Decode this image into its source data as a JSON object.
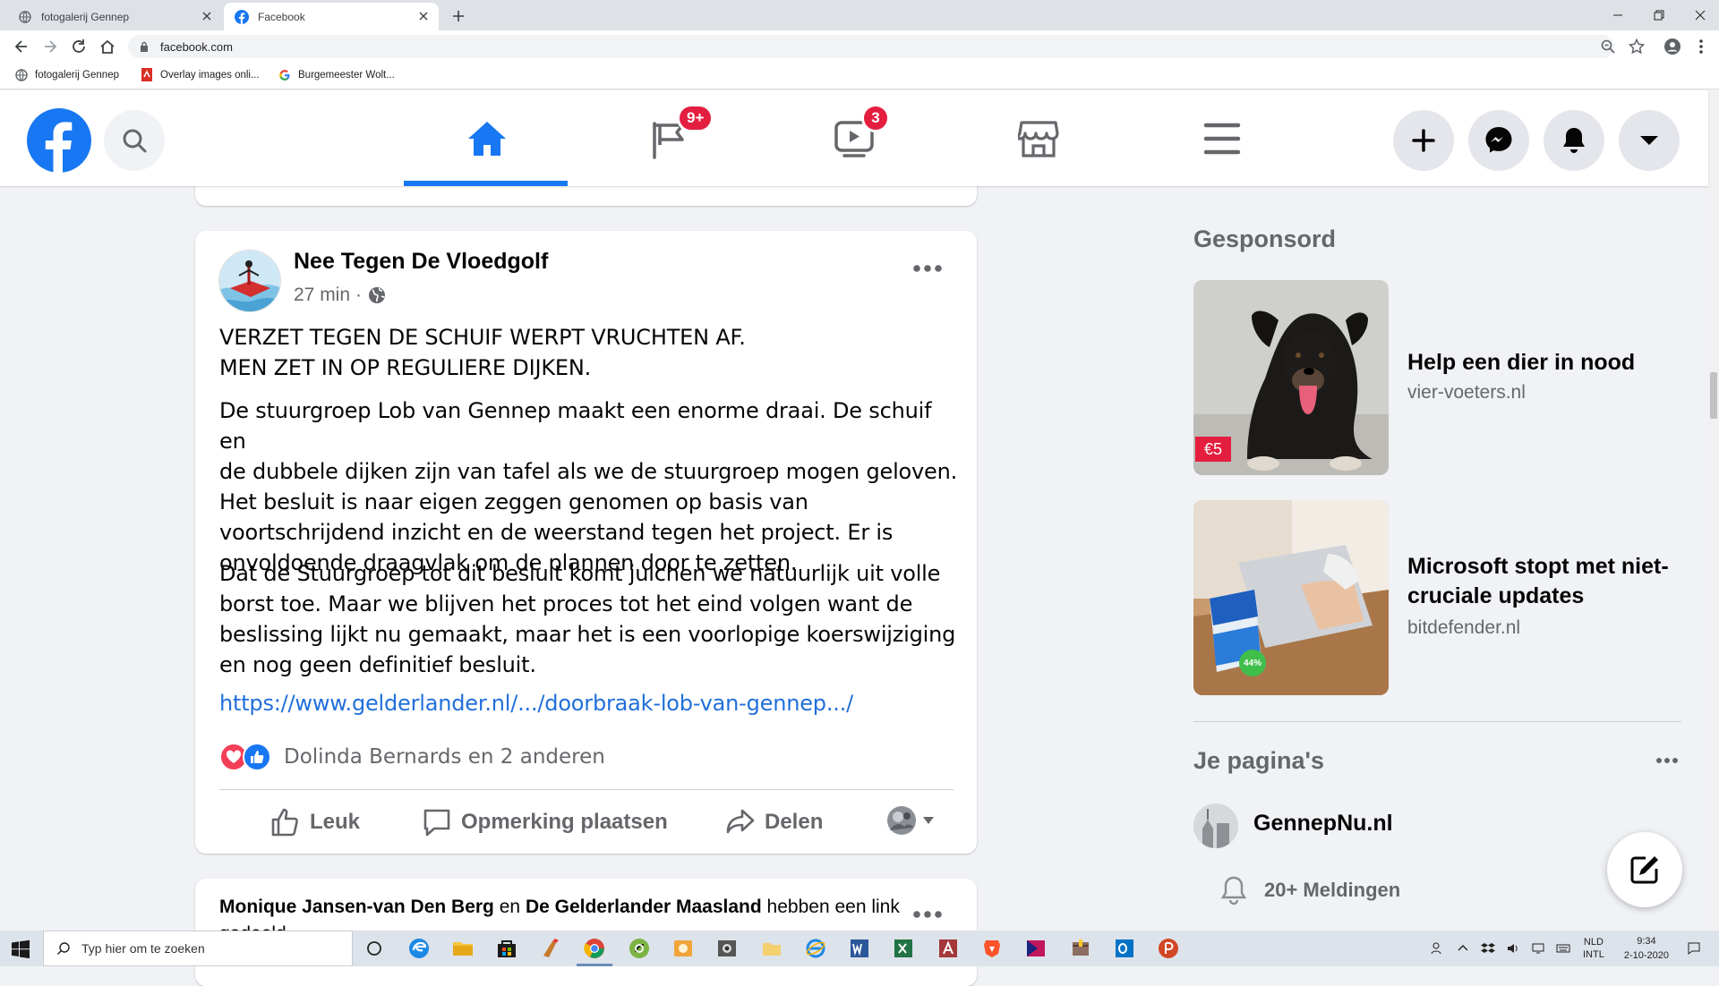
{
  "browser": {
    "tabs": [
      {
        "title": "fotogalerij Gennep",
        "active": false,
        "icon": "globe-icon"
      },
      {
        "title": "Facebook",
        "active": true,
        "icon": "facebook-favicon-icon"
      }
    ],
    "url": "facebook.com",
    "bookmarks": [
      {
        "label": "fotogalerij Gennep",
        "icon": "globe-icon"
      },
      {
        "label": "Overlay images onli...",
        "icon": "pdf-tool-icon"
      },
      {
        "label": "Burgemeester Wolt...",
        "icon": "google-icon"
      }
    ]
  },
  "facebook": {
    "brand_color": "#1877f2",
    "nav": {
      "pages_badge": "9+",
      "watch_badge": "3"
    },
    "feed": {
      "post": {
        "author": "Nee Tegen De Vloedgolf",
        "time": "27 min",
        "separator": "·",
        "headline_lines": [
          "VERZET TEGEN DE SCHUIF WERPT VRUCHTEN AF.",
          "MEN ZET IN OP REGULIERE DIJKEN."
        ],
        "paragraph1_lines": [
          "De stuurgroep Lob van Gennep maakt een enorme draai. De schuif en",
          "de dubbele dijken zijn van tafel als we de stuurgroep mogen geloven.",
          "Het besluit is naar eigen zeggen genomen op basis van",
          "voortschrijdend inzicht en de weerstand tegen het project. Er is",
          "onvoldoende draagvlak om de plannen door te zetten."
        ],
        "paragraph2_lines": [
          "Dat de Stuurgroep tot dit besluit komt juichen we natuurlijk uit volle",
          "borst toe. Maar we blijven het proces tot het eind volgen want de",
          "beslissing lijkt nu gemaakt, maar het is een voorlopige koerswijziging",
          "en nog geen definitief besluit."
        ],
        "link": "https://www.gelderlander.nl/.../doorbraak-lob-van-gennep.../",
        "reactions_text": "Dolinda Bernards en 2 anderen",
        "actions": {
          "like": "Leuk",
          "comment": "Opmerking plaatsen",
          "share": "Delen"
        }
      },
      "next_post": {
        "author1": "Monique Jansen-van Den Berg",
        "connector": "en",
        "author2": "De Gelderlander Maasland",
        "suffix": "hebben een link gedeeld."
      }
    },
    "sidebar": {
      "sponsored_title": "Gesponsord",
      "ads": [
        {
          "title": "Help een dier in nood",
          "site": "vier-voeters.nl",
          "price_badge": "€5"
        },
        {
          "title": "Microsoft stopt met niet-cruciale updates",
          "site": "bitdefender.nl",
          "discount_badge": "44%"
        }
      ],
      "pages_title": "Je pagina's",
      "page_name": "GennepNu.nl",
      "notifications": "20+ Meldingen"
    }
  },
  "taskbar": {
    "search_placeholder": "Typ hier om te zoeken",
    "language": [
      "NLD",
      "INTL"
    ],
    "time": "9:34",
    "date": "2-10-2020"
  }
}
